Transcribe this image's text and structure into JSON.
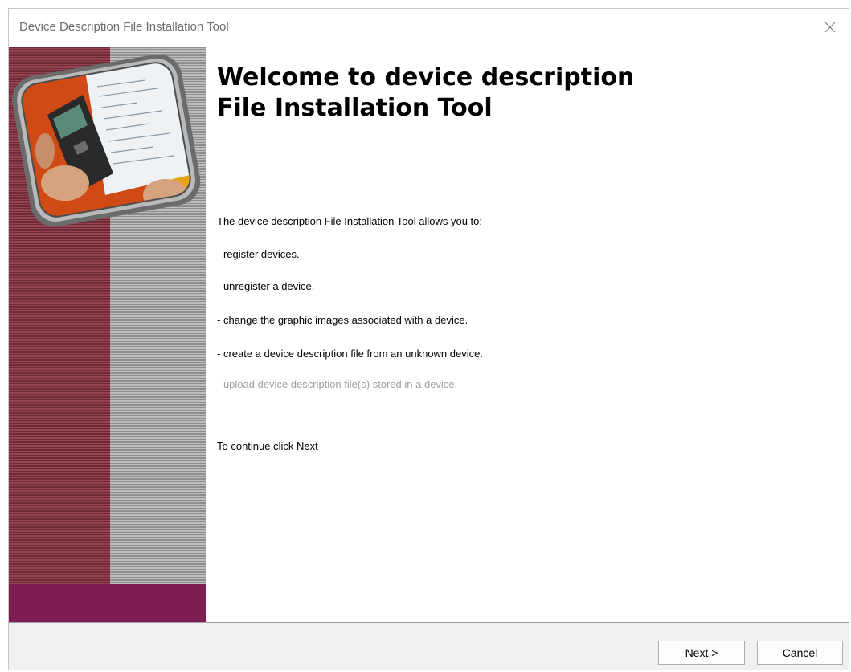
{
  "window": {
    "title": "Device Description File Installation Tool"
  },
  "welcome": {
    "heading_line1": "Welcome to device description",
    "heading_line2": "File Installation Tool",
    "intro": "The device description File Installation Tool allows you to:",
    "items": [
      {
        "text": "- register devices.",
        "enabled": true
      },
      {
        "text": "- unregister a device.",
        "enabled": true
      },
      {
        "text": "- change the graphic images associated with a device.",
        "enabled": true
      },
      {
        "text": "- create a device description file from an unknown device.",
        "enabled": true
      },
      {
        "text": "- upload device description file(s) stored in a device.",
        "enabled": false
      }
    ],
    "continue_text": "To continue click Next"
  },
  "buttons": {
    "next": "Next >",
    "cancel": "Cancel"
  },
  "icons": {
    "close": "close-icon",
    "banner": "device-photo"
  },
  "colors": {
    "sidebar_red": "#8a3a48",
    "sidebar_gray": "#a7a7a7",
    "sidebar_footer": "#7f1d55",
    "disabled_text": "#a0a0a0"
  }
}
